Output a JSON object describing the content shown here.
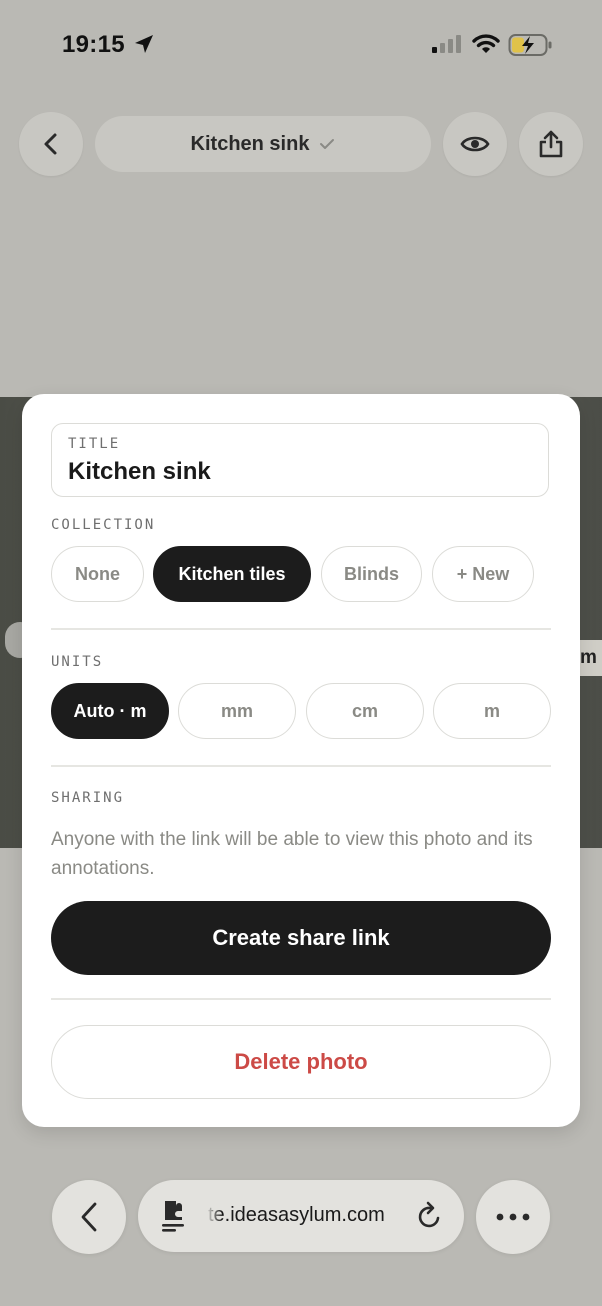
{
  "status_bar": {
    "time": "19:15"
  },
  "header": {
    "title": "Kitchen sink"
  },
  "photo": {
    "right_label": "m"
  },
  "sheet": {
    "title_label": "TITLE",
    "title_value": "Kitchen sink",
    "collection_label": "COLLECTION",
    "collections": [
      "None",
      "Kitchen tiles",
      "Blinds",
      "+ New"
    ],
    "collection_selected": "Kitchen tiles",
    "units_label": "UNITS",
    "units": [
      "Auto · m",
      "mm",
      "cm",
      "m"
    ],
    "unit_selected": "Auto · m",
    "sharing_label": "SHARING",
    "sharing_text": "Anyone with the link will be able to view this photo and its annotations.",
    "create_link_label": "Create share link",
    "delete_label": "Delete photo"
  },
  "browser": {
    "url": "te.ideasasylum.com"
  },
  "colors": {
    "dark": "#1c1c1c",
    "danger": "#cc4a46",
    "backdrop": "#bab9b4"
  }
}
